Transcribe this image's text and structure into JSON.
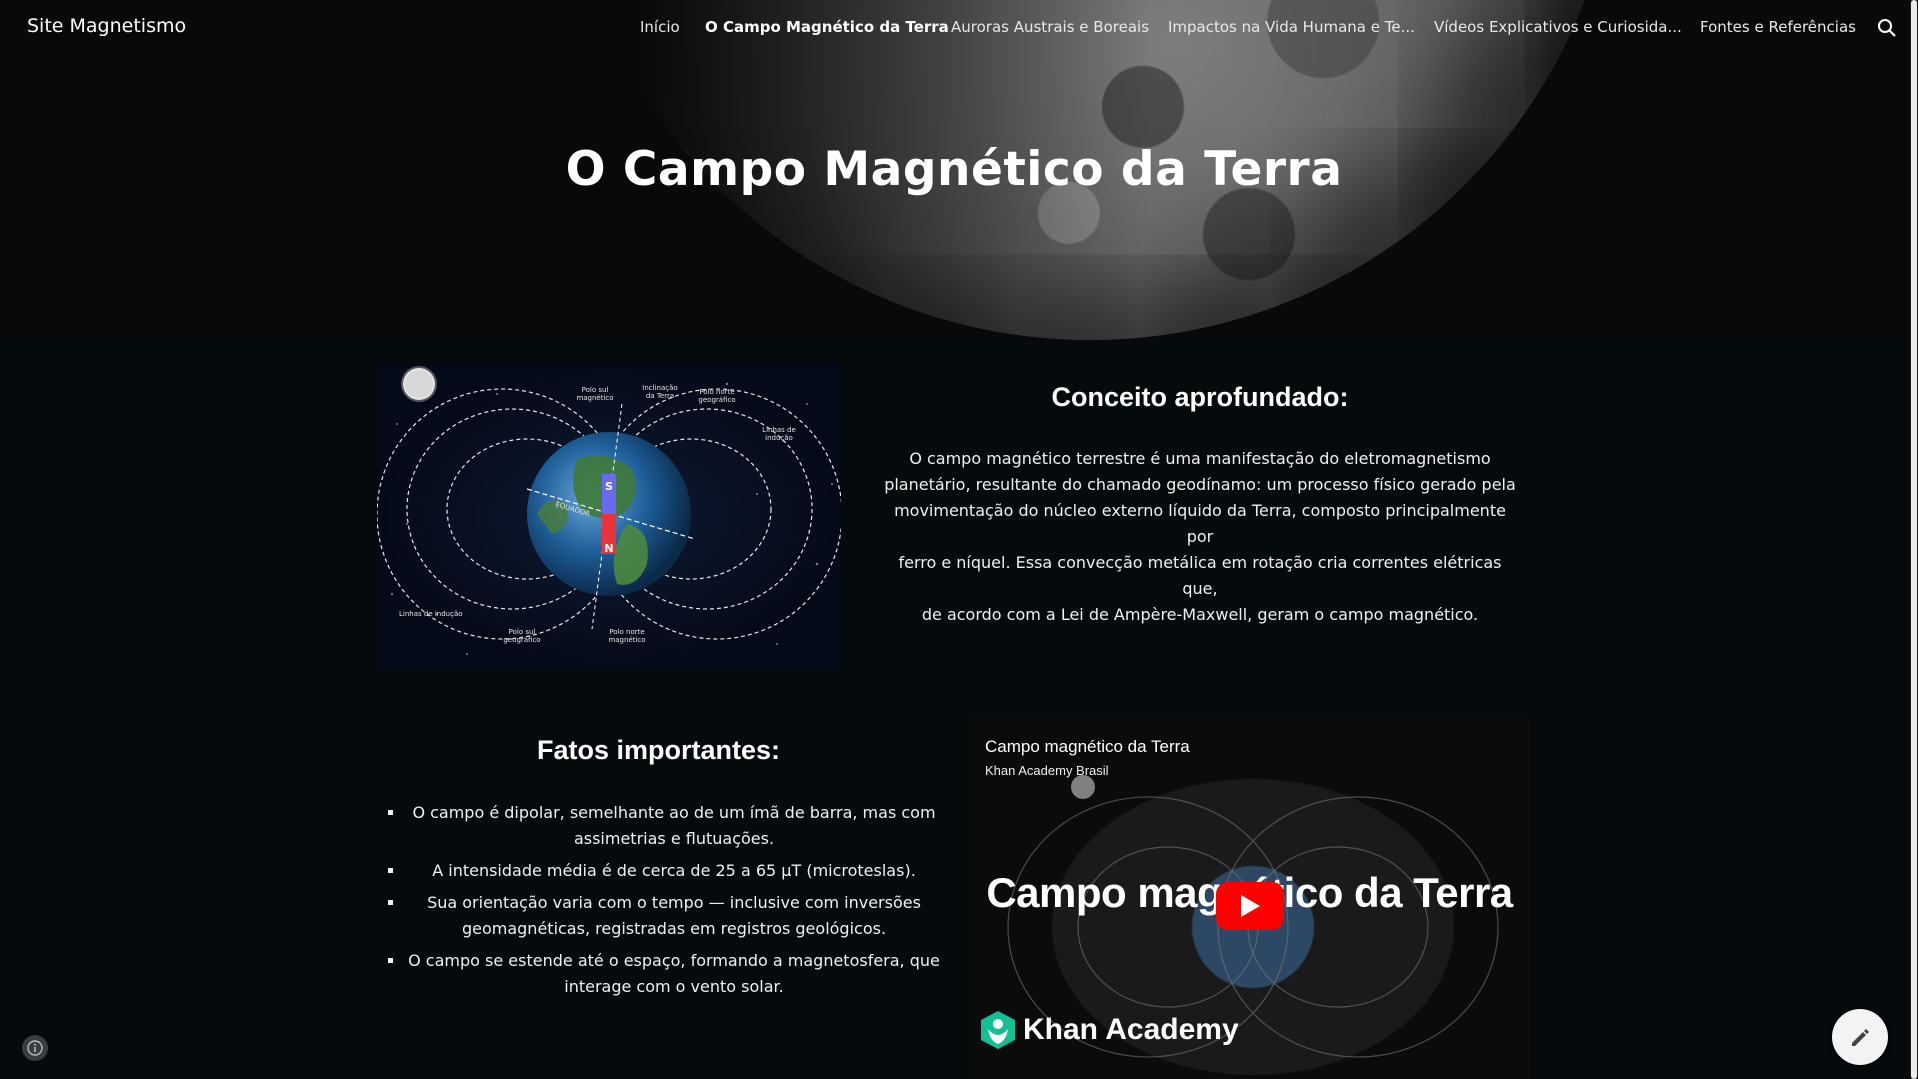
{
  "site": {
    "title": "Site Magnetismo"
  },
  "nav": {
    "items": [
      {
        "label": "Início",
        "active": false
      },
      {
        "label": "O Campo Magnético da Terra",
        "active": true
      },
      {
        "label": "Auroras Austrais e Boreais",
        "active": false
      },
      {
        "label": "Impactos na Vida Humana e Te...",
        "active": false
      },
      {
        "label": "Vídeos Explicativos e Curiosida...",
        "active": false
      },
      {
        "label": "Fontes e Referências",
        "active": false
      }
    ],
    "search_icon": "search-icon"
  },
  "hero": {
    "title": "O Campo Magnético da Terra"
  },
  "figure": {
    "labels": {
      "polo_sul_magnetico": [
        "Polo sul",
        "magnético"
      ],
      "inclinacao": [
        "Inclinação",
        "da Terra"
      ],
      "polo_norte_geografico": [
        "Polo norte",
        "geográfico"
      ],
      "linhas_inducao_top": [
        "Linhas de",
        "indução"
      ],
      "equador": "EQUADOR",
      "linhas_inducao_bottom": "Linhas de indução",
      "polo_sul_geografico": [
        "Polo sul",
        "geográfico"
      ],
      "polo_norte_magnetico": [
        "Polo norte",
        "magnético"
      ],
      "magnet_s": "S",
      "magnet_n": "N"
    }
  },
  "concept": {
    "heading": "Conceito aprofundado:",
    "lines": [
      "O campo magnético terrestre é uma manifestação do eletromagnetismo",
      "planetário, resultante do chamado geodínamo: um processo físico gerado pela",
      "movimentação do núcleo externo líquido da Terra, composto principalmente por",
      "ferro e níquel. Essa convecção metálica em rotação cria correntes elétricas que,",
      "de acordo com a Lei de Ampère-Maxwell, geram o campo magnético."
    ]
  },
  "facts": {
    "heading": "Fatos importantes:",
    "items": [
      "O campo é dipolar, semelhante ao de um ímã de barra, mas com assimetrias e flutuações.",
      "A intensidade média é de cerca de 25 a 65 µT (microteslas).",
      "Sua orientação varia com o tempo — inclusive com inversões geomagnéticas, registradas em registros geológicos.",
      "O campo se estende até o espaço, formando a magnetosfera, que interage com o vento solar."
    ]
  },
  "video": {
    "title": "Campo magnético da Terra",
    "channel": "Khan Academy Brasil",
    "overlay_text": "Campo magnético da Terra",
    "brand": "Khan Academy",
    "colors": {
      "play": "#ff0000",
      "brand": "#14bf96"
    }
  },
  "colors": {
    "background": "#050a0d",
    "text": "#ffffff"
  }
}
